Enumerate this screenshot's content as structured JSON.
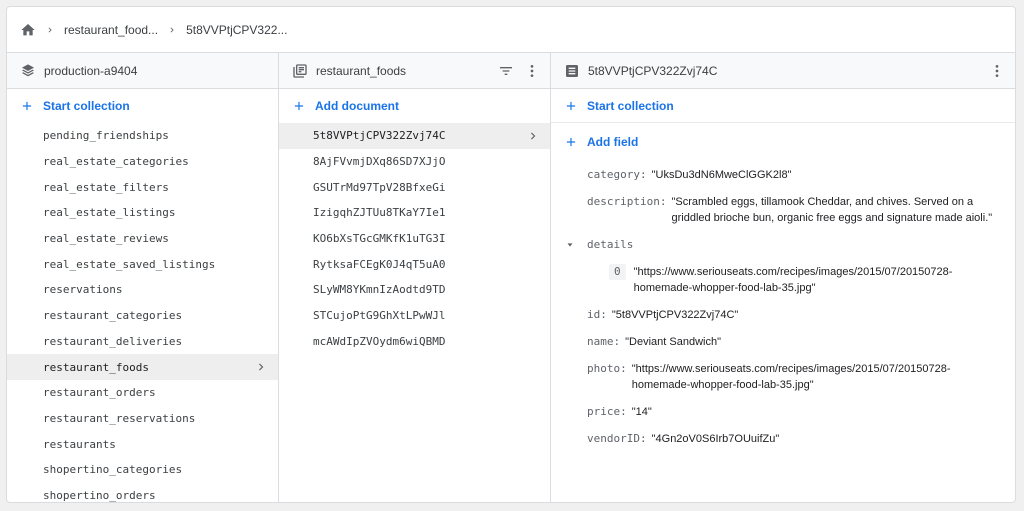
{
  "breadcrumb": {
    "items": [
      "restaurant_food...",
      "5t8VVPtjCPV322..."
    ]
  },
  "col1": {
    "header": "production-a9404",
    "action": "Start collection",
    "items": [
      "pending_friendships",
      "real_estate_categories",
      "real_estate_filters",
      "real_estate_listings",
      "real_estate_reviews",
      "real_estate_saved_listings",
      "reservations",
      "restaurant_categories",
      "restaurant_deliveries",
      "restaurant_foods",
      "restaurant_orders",
      "restaurant_reservations",
      "restaurants",
      "shopertino_categories",
      "shopertino_orders"
    ],
    "selected_index": 9
  },
  "col2": {
    "header": "restaurant_foods",
    "action": "Add document",
    "items": [
      "5t8VVPtjCPV322Zvj74C",
      "8AjFVvmjDXq86SD7XJjO",
      "GSUTrMd97TpV28BfxeGi",
      "IzigqhZJTUu8TKaY7Ie1",
      "KO6bXsTGcGMKfK1uTG3I",
      "RytksaFCEgK0J4qT5uA0",
      "SLyWM8YKmnIzAodtd9TD",
      "STCujoPtG9GhXtLPwWJl",
      "mcAWdIpZVOydm6wiQBMD"
    ],
    "selected_index": 0
  },
  "col3": {
    "header": "5t8VVPtjCPV322Zvj74C",
    "action_collection": "Start collection",
    "action_field": "Add field",
    "fields": {
      "category": {
        "key": "category:",
        "value": "\"UksDu3dN6MweClGGK2l8\""
      },
      "description": {
        "key": "description:",
        "value": "\"Scrambled eggs, tillamook Cheddar, and chives. Served on a griddled brioche bun, organic free eggs and signature made aioli.\""
      },
      "details": {
        "key": "details",
        "index": "0",
        "value": "\"https://www.seriouseats.com/recipes/images/2015/07/20150728-homemade-whopper-food-lab-35.jpg\""
      },
      "id": {
        "key": "id:",
        "value": "\"5t8VVPtjCPV322Zvj74C\""
      },
      "name": {
        "key": "name:",
        "value": "\"Deviant Sandwich\""
      },
      "photo": {
        "key": "photo:",
        "value": "\"https://www.seriouseats.com/recipes/images/2015/07/20150728-homemade-whopper-food-lab-35.jpg\""
      },
      "price": {
        "key": "price:",
        "value": "\"14\""
      },
      "vendorID": {
        "key": "vendorID:",
        "value": "\"4Gn2oV0S6Irb7OUuifZu\""
      }
    }
  },
  "colors": {
    "accent": "#1a73e8",
    "selected_row": "#eeeeee",
    "border": "#dadce0"
  },
  "icons": [
    "home-icon",
    "chevron-right-icon",
    "database-icon",
    "collection-icon",
    "filter-icon",
    "more-vert-icon",
    "document-icon",
    "plus-icon",
    "expand-triangle-icon"
  ]
}
